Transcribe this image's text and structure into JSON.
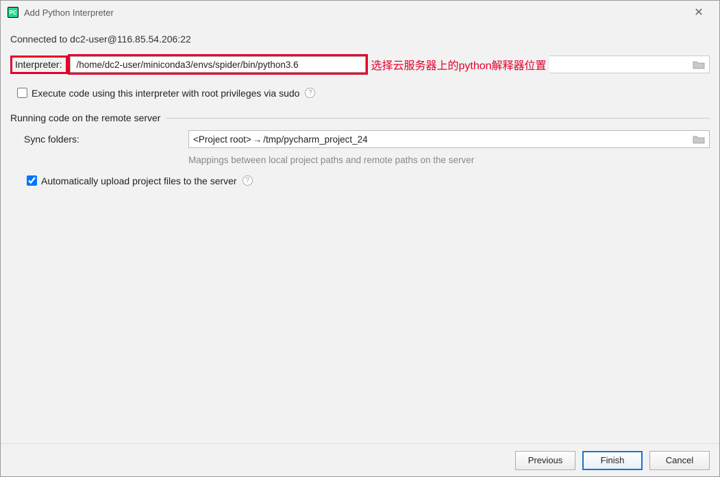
{
  "window": {
    "title": "Add Python Interpreter"
  },
  "connected_text": "Connected to dc2-user@116.85.54.206:22",
  "interpreter": {
    "label": "Interpreter:",
    "path": "/home/dc2-user/miniconda3/envs/spider/bin/python3.6",
    "annotation": "选择云服务器上的python解释器位置"
  },
  "execute_sudo": {
    "label": "Execute code using this interpreter with root privileges via sudo",
    "checked": false
  },
  "remote_section": {
    "title": "Running code on the remote server"
  },
  "sync": {
    "label": "Sync folders:",
    "project_root": "<Project root>",
    "remote_path": "/tmp/pycharm_project_24",
    "note": "Mappings between local project paths and remote paths on the server"
  },
  "auto_upload": {
    "label": "Automatically upload project files to the server",
    "checked": true
  },
  "buttons": {
    "previous": "Previous",
    "finish": "Finish",
    "cancel": "Cancel"
  }
}
